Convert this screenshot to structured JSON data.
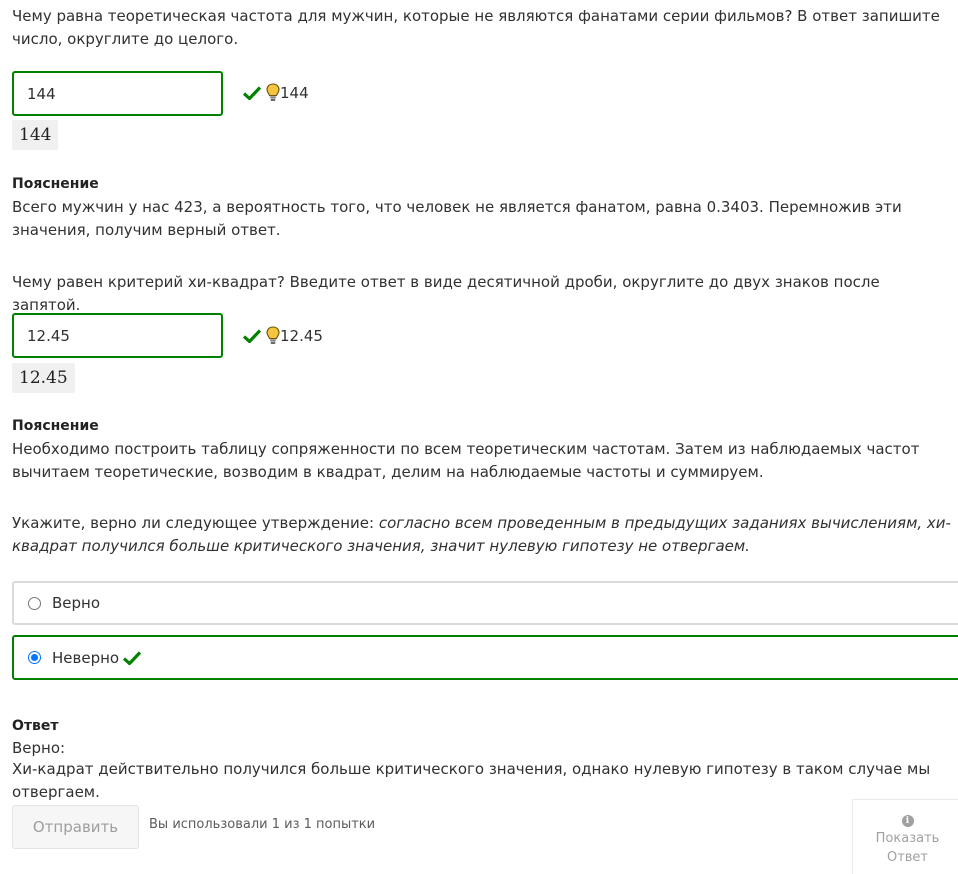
{
  "q1": {
    "prompt": "Чему равна теоретическая частота для мужчин, которые не являются фанатами серии фильмов? В ответ запишите число, округлите до целого.",
    "value": "144",
    "status_value": "144",
    "preview": "144"
  },
  "expl1": {
    "heading": "Пояснение",
    "text": "Всего мужчин у нас 423, а вероятность того, что человек не является фанатом, равна 0.3403. Перемножив эти значения, получим верный ответ."
  },
  "q2": {
    "prompt": "Чему равен критерий хи-квадрат? Введите ответ в виде десятичной дроби, округлите до двух знаков после запятой.",
    "value": "12.45",
    "status_value": "12.45",
    "preview": "12.45"
  },
  "expl2": {
    "heading": "Пояснение",
    "text": "Необходимо построить таблицу сопряженности по всем теоретическим частотам. Затем из наблюдаемых частот вычитаем теоретические, возводим в квадрат, делим на наблюдаемые частоты и суммируем."
  },
  "q3": {
    "prompt_plain": "Укажите, верно ли следующее утверждение: ",
    "prompt_italic": "согласно всем проведенным в предыдущих заданиях вычислениям, хи-квадрат получился больше критического значения, значит нулевую гипотезу не отвергаем.",
    "options": [
      {
        "label": "Верно",
        "selected": false
      },
      {
        "label": "Неверно",
        "selected": true
      }
    ]
  },
  "answer": {
    "heading": "Ответ",
    "verdict": "Верно:",
    "text": "Хи-кадрат действительно получился больше критического значения, однако нулевую гипотезу в таком случае мы отвергаем."
  },
  "footer": {
    "submit_label": "Отправить",
    "attempts_text": "Вы использовали 1 из 1 попытки",
    "show_answer_line1": "Показать",
    "show_answer_line2": "Ответ"
  },
  "colors": {
    "correct": "#008100",
    "hint": "#f0b429",
    "radio": "#0075ff"
  },
  "icons": {
    "correct": "checkmark-icon",
    "hint": "lightbulb-icon",
    "info": "info-icon"
  }
}
